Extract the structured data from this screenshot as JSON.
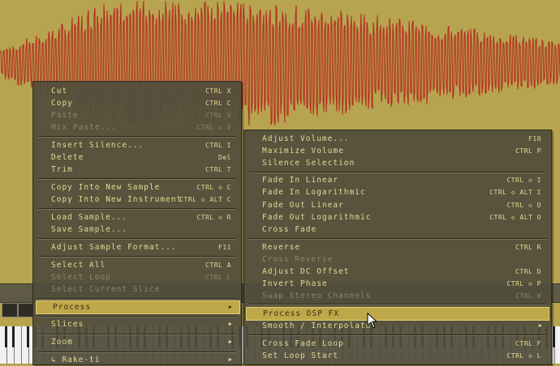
{
  "editor": {
    "waveform_color": "#b4271f",
    "background_color": "#b7a450"
  },
  "main_menu": {
    "items": [
      {
        "label": "Cut",
        "shortcut": "CTRL X",
        "disabled": false
      },
      {
        "label": "Copy",
        "shortcut": "CTRL C",
        "disabled": false
      },
      {
        "label": "Paste",
        "shortcut": "CTRL V",
        "disabled": true
      },
      {
        "label": "Mix Paste...",
        "shortcut": "CTRL ◇ V",
        "disabled": true
      },
      {
        "label": "Insert Silence...",
        "shortcut": "CTRL I",
        "disabled": false
      },
      {
        "label": "Delete",
        "shortcut": "Del",
        "disabled": false
      },
      {
        "label": "Trim",
        "shortcut": "CTRL T",
        "disabled": false
      },
      {
        "label": "Copy Into New Sample",
        "shortcut": "CTRL ◇ C",
        "disabled": false
      },
      {
        "label": "Copy Into New Instrument",
        "shortcut": "CTRL ◇ ALT C",
        "disabled": false
      },
      {
        "label": "Load Sample...",
        "shortcut": "CTRL ◇ R",
        "disabled": false
      },
      {
        "label": "Save Sample...",
        "shortcut": "",
        "disabled": false
      },
      {
        "label": "Adjust Sample Format...",
        "shortcut": "F11",
        "disabled": false
      },
      {
        "label": "Select All",
        "shortcut": "CTRL A",
        "disabled": false
      },
      {
        "label": "Select Loop",
        "shortcut": "CTRL L",
        "disabled": true
      },
      {
        "label": "Select Current Slice",
        "shortcut": "",
        "disabled": true
      },
      {
        "label": "Process",
        "shortcut": "",
        "disabled": false
      },
      {
        "label": "Slices",
        "shortcut": "",
        "disabled": false
      },
      {
        "label": "Zoom",
        "shortcut": "",
        "disabled": false
      },
      {
        "label": "↳ Rake-ti",
        "shortcut": "",
        "disabled": false
      }
    ]
  },
  "sub_menu": {
    "items": [
      {
        "label": "Adjust Volume...",
        "shortcut": "F10",
        "disabled": false
      },
      {
        "label": "Maximize Volume",
        "shortcut": "CTRL P",
        "disabled": false
      },
      {
        "label": "Silence Selection",
        "shortcut": "",
        "disabled": false
      },
      {
        "label": "Fade In Linear",
        "shortcut": "CTRL ◇ I",
        "disabled": false
      },
      {
        "label": "Fade In Logarithmic",
        "shortcut": "CTRL ◇ ALT I",
        "disabled": false
      },
      {
        "label": "Fade Out Linear",
        "shortcut": "CTRL ◇ O",
        "disabled": false
      },
      {
        "label": "Fade Out Logarithmic",
        "shortcut": "CTRL ◇ ALT O",
        "disabled": false
      },
      {
        "label": "Cross Fade",
        "shortcut": "",
        "disabled": false
      },
      {
        "label": "Reverse",
        "shortcut": "CTRL R",
        "disabled": false
      },
      {
        "label": "Cross Reverse",
        "shortcut": "",
        "disabled": true
      },
      {
        "label": "Adjust DC Offset",
        "shortcut": "CTRL D",
        "disabled": false
      },
      {
        "label": "Invert Phase",
        "shortcut": "CTRL ◇ P",
        "disabled": false
      },
      {
        "label": "Swap Stereo Channels",
        "shortcut": "CTRL W",
        "disabled": true
      },
      {
        "label": "Process DSP FX",
        "shortcut": "",
        "disabled": false
      },
      {
        "label": "Smooth / Interpolate",
        "shortcut": "",
        "disabled": false
      },
      {
        "label": "Cross Fade Loop",
        "shortcut": "CTRL F",
        "disabled": false
      },
      {
        "label": "Set Loop Start",
        "shortcut": "CTRL ◇ L",
        "disabled": false
      }
    ]
  }
}
